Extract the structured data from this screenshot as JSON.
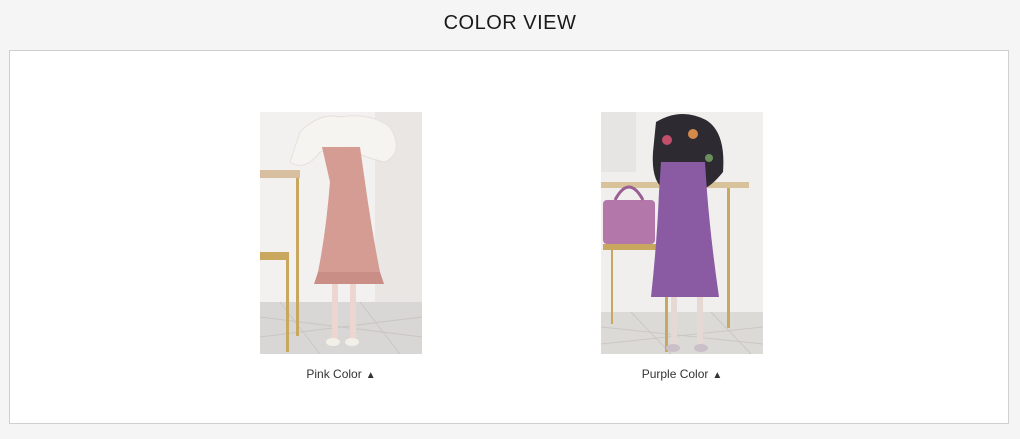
{
  "page": {
    "title": "COLOR VIEW"
  },
  "colors": {
    "pink_skirt": "#d49c93",
    "purple_skirt": "#8a5aa2",
    "background": "#f5f5f5",
    "panel_border": "#cfcfcf"
  },
  "products": [
    {
      "caption": "Pink Color",
      "arrow": "▲",
      "icon": "up-triangle-icon"
    },
    {
      "caption": "Purple Color",
      "arrow": "▲",
      "icon": "up-triangle-icon"
    }
  ]
}
